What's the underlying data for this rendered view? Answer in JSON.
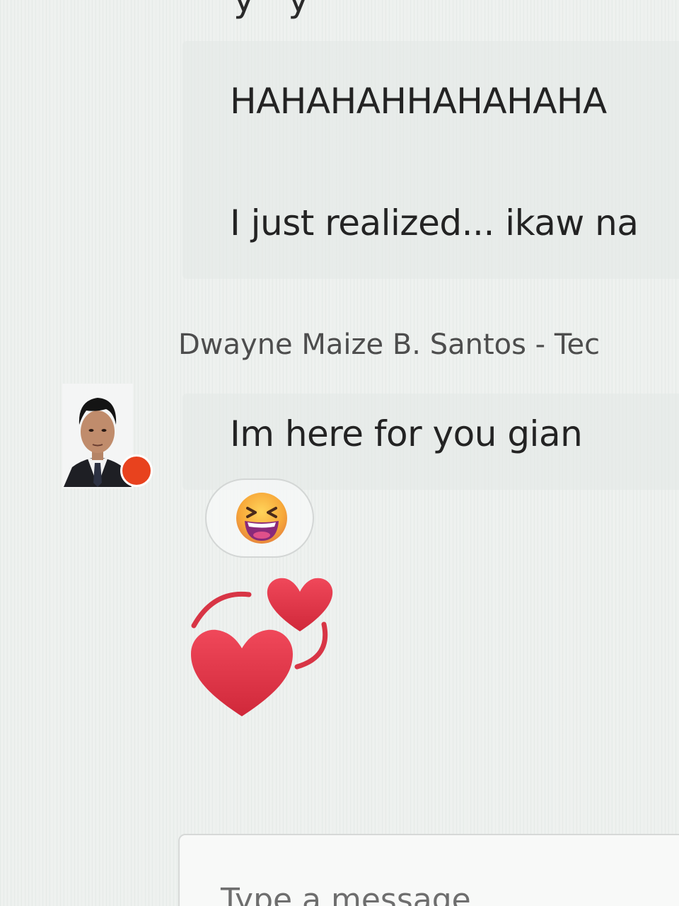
{
  "chat": {
    "messages": [
      {
        "text": "HAHAHAHHAHAHAHA"
      },
      {
        "text": "I just realized... ikaw na"
      }
    ],
    "sender": {
      "name": "Dwayne Maize B. Santos - Tec"
    },
    "reply": {
      "text": "Im here for you gian",
      "reaction": "grinning-squinting-face-icon"
    },
    "sticker": "two-hearts-icon"
  },
  "compose": {
    "placeholder": "Type a message"
  },
  "colors": {
    "presence": "#e8421e",
    "heart": "#e23a4a",
    "background": "#eef1ef"
  }
}
